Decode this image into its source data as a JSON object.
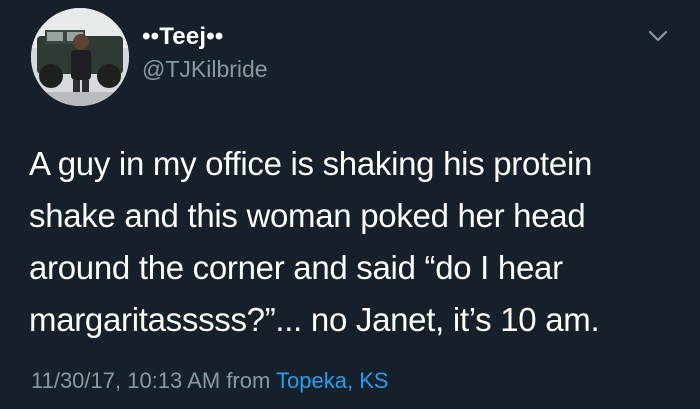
{
  "user": {
    "display_name": "••Teej••",
    "handle": "@TJKilbride"
  },
  "tweet": {
    "lines": [
      "A guy in my office is shaking his protein",
      "shake and this woman poked her head",
      "around the corner and said “do I hear",
      "margaritasssss?”... no Janet, it’s 10 am."
    ],
    "timestamp": "11/30/17, 10:13 AM",
    "from_label": "from",
    "location": "Topeka, KS"
  },
  "icons": {
    "menu": "chevron-down-icon",
    "avatar": "profile-photo"
  },
  "colors": {
    "background": "#15202b",
    "text": "#ffffff",
    "secondary": "#8899a6",
    "link": "#1da1f2"
  }
}
